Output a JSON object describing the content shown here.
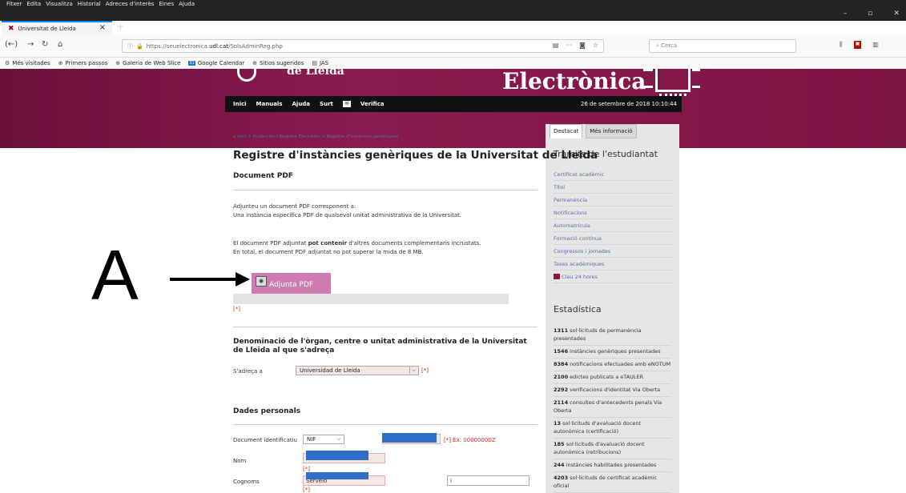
{
  "browser": {
    "menu": [
      "Fitxer",
      "Edita",
      "Visualitza",
      "Historial",
      "Adreces d'interès",
      "Eines",
      "Ajuda"
    ],
    "tab_title": "Universitat de Lleida",
    "url_prefix": "https://seuelectronica.",
    "url_host": "udl.cat",
    "url_path": "/SolsAdminReg.php",
    "search_placeholder": "Cerca",
    "bookmarks": [
      "Més visitades",
      "Primers passos",
      "Galeria de Web Slice",
      "Google Calendar",
      "Sitios sugeridos",
      "JAS"
    ]
  },
  "banner": {
    "left_text": "de Lleida",
    "right_text": "Electrònica"
  },
  "sitenav": {
    "items": [
      "Inici",
      "Manuals",
      "Ajuda",
      "Surt",
      "Verifica"
    ],
    "datetime": "26 de setembre de 2018 10:10:44"
  },
  "breadcrumb": "Inici > Instàncies i Registre Electrònic > Registre d'instàncies genèriques",
  "page_title": "Registre d'instàncies genèriques de la Universitat de Lleida",
  "section_pdf": {
    "heading": "Document PDF",
    "text1": "Adjunteu un document PDF corresponent a:",
    "text2": "Una instància específica PDF de qualsevol unitat administrativa de la Universitat.",
    "text3_a": "El document PDF adjuntat ",
    "text3_b": "pot contenir",
    "text3_c": " d'altres documents complementaris incrustats.",
    "text4": "En total, el document PDF adjuntat no pot superar la mida de 8 MB.",
    "button": "Adjunta PDF",
    "required": "[*]"
  },
  "section_org": {
    "heading": "Denominació de l'òrgan, centre o unitat administrativa de la Universitat de Lleida al que s'adreça",
    "label": "S'adreça a",
    "value": "Universidad de Lleida",
    "required": "[*]"
  },
  "section_personal": {
    "heading": "Dades personals",
    "doc_label": "Document identificatiu",
    "doc_type": "NIF",
    "doc_hint": "[*] Ex. 00000000Z",
    "nom_label": "Nom",
    "cognoms_label": "Cognoms",
    "cognoms_value": "Servelo",
    "cognoms2_value": "i",
    "required": "[*]"
  },
  "sidebar": {
    "tabs": [
      "Destacat",
      "Més informació"
    ],
    "tramits_title": "Tràmits de l'estudiantat",
    "links": [
      "Certificat acadèmic",
      "Títol",
      "Permanència",
      "Notificacions",
      "Automatrícula",
      "Formació contínua",
      "Congressos i jornades",
      "Taxes acadèmiques",
      "Clau 24 hores"
    ],
    "stats_title": "Estadística",
    "stats": [
      {
        "n": "1311",
        "t": "sol·licituds de permanència presentades"
      },
      {
        "n": "1546",
        "t": "instàncies genèriques presentades"
      },
      {
        "n": "8384",
        "t": "notificacions efectuades amb eNOTUM"
      },
      {
        "n": "2100",
        "t": "edictes publicats a eTAULER"
      },
      {
        "n": "2292",
        "t": "verificacions d'identitat Via Oberta"
      },
      {
        "n": "2114",
        "t": "consultes d'antecedents penals Via Oberta"
      },
      {
        "n": "13",
        "t": "sol·licituds d'avaluació docent autonòmica (certificació)"
      },
      {
        "n": "185",
        "t": "sol·licituds d'avaluació docent autonòmica (retribucions)"
      },
      {
        "n": "244",
        "t": "instàncies habilitades presentades"
      },
      {
        "n": "4203",
        "t": "sol·licituds de certificat acadèmic oficial"
      }
    ]
  },
  "annotation": {
    "letter": "A"
  }
}
